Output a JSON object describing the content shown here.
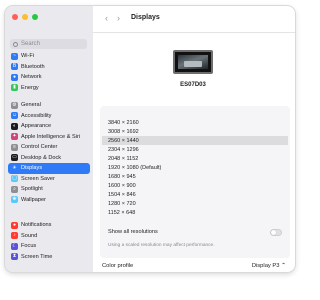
{
  "search": {
    "placeholder": "Search"
  },
  "sidebar": {
    "group1": [
      {
        "label": "Wi-Fi",
        "icon": "wifi-icon",
        "color": "#2f7af6",
        "glyph": "~"
      },
      {
        "label": "Bluetooth",
        "icon": "bluetooth-icon",
        "color": "#2f7af6",
        "glyph": "B"
      },
      {
        "label": "Network",
        "icon": "network-icon",
        "color": "#2f7af6",
        "glyph": "●"
      },
      {
        "label": "Energy",
        "icon": "battery-icon",
        "color": "#34c759",
        "glyph": "▮"
      }
    ],
    "group2": [
      {
        "label": "General",
        "icon": "gear-icon",
        "color": "#8e8e93",
        "glyph": "⚙"
      },
      {
        "label": "Accessibility",
        "icon": "accessibility-icon",
        "color": "#2f7af6",
        "glyph": "☺"
      },
      {
        "label": "Appearance",
        "icon": "appearance-icon",
        "color": "#1c1c1e",
        "glyph": "◐"
      },
      {
        "label": "Apple Intelligence & Siri",
        "icon": "siri-icon",
        "color": "#d0457a",
        "glyph": "✦"
      },
      {
        "label": "Control Center",
        "icon": "control-center-icon",
        "color": "#8e8e93",
        "glyph": "≡"
      },
      {
        "label": "Desktop & Dock",
        "icon": "desktop-dock-icon",
        "color": "#1c1c1e",
        "glyph": "▭"
      },
      {
        "label": "Displays",
        "icon": "displays-icon",
        "color": "#ffffff",
        "glyph": "☀",
        "active": true
      },
      {
        "label": "Screen Saver",
        "icon": "screen-saver-icon",
        "color": "#5ac8fa",
        "glyph": "▢"
      },
      {
        "label": "Spotlight",
        "icon": "spotlight-icon",
        "color": "#8e8e93",
        "glyph": "⌕"
      },
      {
        "label": "Wallpaper",
        "icon": "wallpaper-icon",
        "color": "#5ac8fa",
        "glyph": "❀"
      }
    ],
    "group3": [
      {
        "label": "Notifications",
        "icon": "notifications-icon",
        "color": "#ff3b30",
        "glyph": "●"
      },
      {
        "label": "Sound",
        "icon": "sound-icon",
        "color": "#ff3b30",
        "glyph": "♪"
      },
      {
        "label": "Focus",
        "icon": "focus-icon",
        "color": "#5856d6",
        "glyph": "☾"
      },
      {
        "label": "Screen Time",
        "icon": "screen-time-icon",
        "color": "#5856d6",
        "glyph": "⧗"
      }
    ]
  },
  "toolbar": {
    "title": "Displays",
    "back": "‹",
    "forward": "›"
  },
  "display": {
    "name": "ES07D03"
  },
  "resolutions": {
    "selected": "2560 × 1440",
    "items": [
      "3840 × 2160",
      "3008 × 1692",
      "2560 × 1440",
      "2304 × 1296",
      "2048 × 1152",
      "1920 × 1080 (Default)",
      "1680 × 945",
      "1600 × 900",
      "1504 × 846",
      "1280 × 720",
      "1152 × 648"
    ]
  },
  "show_all": {
    "label": "Show all resolutions",
    "on": false
  },
  "hint": "Using a scaled resolution may affect performance.",
  "color_profile": {
    "label": "Color profile",
    "value": "Display P3 ⌃"
  }
}
